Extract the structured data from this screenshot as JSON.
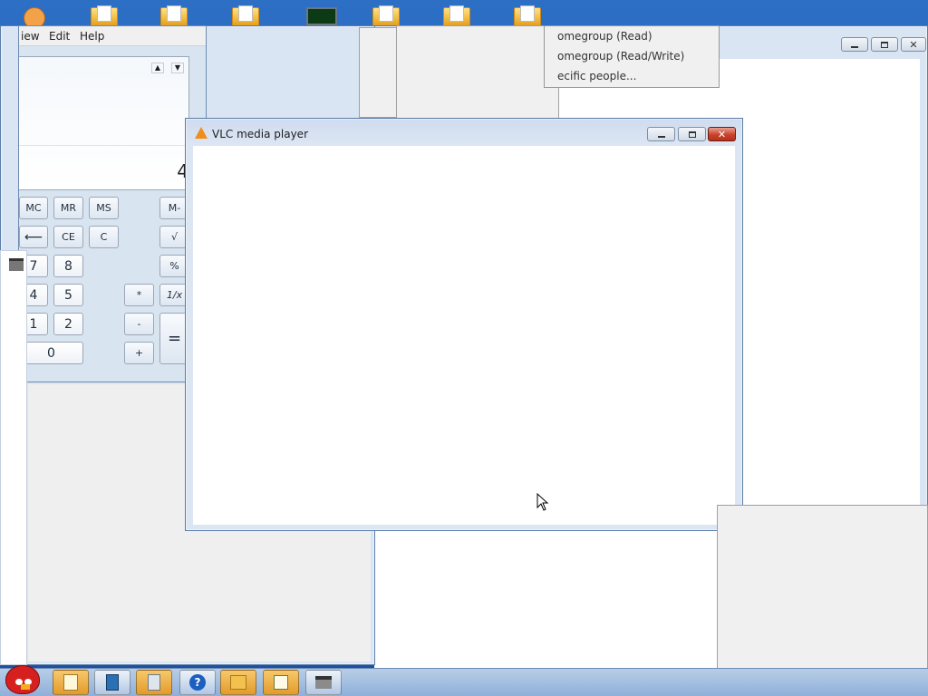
{
  "desktop": {
    "icons": [
      {
        "name": "folder-icon",
        "x_hint": "1"
      },
      {
        "name": "folder-icon",
        "x_hint": "2"
      },
      {
        "name": "folder-icon",
        "x_hint": "3"
      },
      {
        "name": "monitor-icon",
        "x_hint": "4"
      },
      {
        "name": "folder-icon",
        "x_hint": "5"
      },
      {
        "name": "folder-icon",
        "x_hint": "6"
      },
      {
        "name": "folder-icon",
        "x_hint": "7"
      }
    ]
  },
  "calculator": {
    "menu": {
      "view": "iew",
      "edit": "Edit",
      "help": "Help"
    },
    "display_value": "4",
    "buttons": {
      "mc": "MC",
      "mr": "MR",
      "ms": "MS",
      "mminus": "M-",
      "backspace": "⟵",
      "ce": "CE",
      "c": "C",
      "sqrt": "√",
      "seven": "7",
      "eight": "8",
      "percent": "%",
      "four": "4",
      "five": "5",
      "multiply": "*",
      "reciprocal": "1/x",
      "one": "1",
      "two": "2",
      "minus": "-",
      "equals": "=",
      "zero": "0",
      "plus": "+"
    }
  },
  "vlc": {
    "title": "VLC media player"
  },
  "share_menu": {
    "items": [
      "omegroup (Read)",
      "omegroup (Read/Write)",
      "ecific people..."
    ]
  },
  "taskbar": {
    "items": [
      "angry-bird-start-icon",
      "notepad-icon",
      "book-icon",
      "calculator-icon",
      "help-icon",
      "folder-icon",
      "notepad-pen-icon",
      "printer-icon"
    ]
  },
  "colors": {
    "desktop_blue": "#1d4f9c",
    "vlc_title_text": "#1e1e1e",
    "close_red": "#c8432a"
  }
}
